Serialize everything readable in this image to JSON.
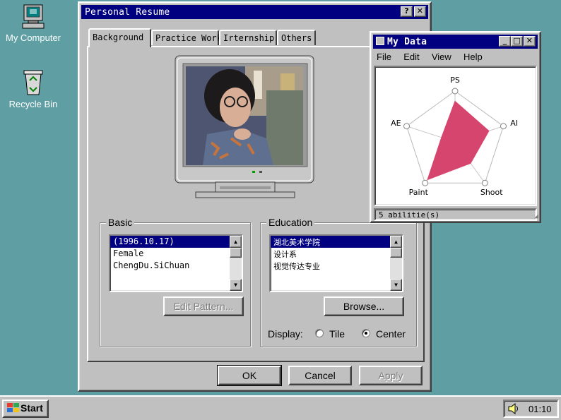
{
  "desktop": {
    "icons": [
      {
        "label": "My Computer",
        "icon": "computer-icon"
      },
      {
        "label": "Recycle Bin",
        "icon": "recycle-bin-icon"
      }
    ]
  },
  "dialog": {
    "title": "Personal Resume",
    "help_btn": "?",
    "close_btn": "✕",
    "tabs": [
      {
        "label": "Background",
        "active": true
      },
      {
        "label": "Practice Work"
      },
      {
        "label": "Irternship"
      },
      {
        "label": "Others"
      }
    ],
    "basic": {
      "title": "Basic",
      "items": [
        "(1996.10.17)",
        "Female",
        "ChengDu.SiChuan"
      ],
      "selected_index": 0,
      "edit_pattern_label": "Edit Pattern..."
    },
    "education": {
      "title": "Education",
      "items": [
        "湖北美术学院",
        "设计系",
        "视觉传达专业"
      ],
      "selected_index": 0,
      "browse_label": "Browse...",
      "display_label": "Display:",
      "tile_label": "Tile",
      "center_label": "Center",
      "display_selected": "Center"
    },
    "ok_label": "OK",
    "cancel_label": "Cancel",
    "apply_label": "Apply"
  },
  "mydata": {
    "title": "My Data",
    "menus": [
      "File",
      "Edit",
      "View",
      "Help"
    ],
    "status": "5 abilitie(s)",
    "accent": "#d6456e"
  },
  "chart_data": {
    "type": "radar",
    "categories": [
      "PS",
      "AI",
      "Shoot",
      "Paint",
      "AE"
    ],
    "values": [
      0.8,
      0.7,
      0.52,
      0.92,
      0.28
    ],
    "range": [
      0,
      1
    ]
  },
  "taskbar": {
    "start_label": "Start",
    "clock": "01:10"
  }
}
